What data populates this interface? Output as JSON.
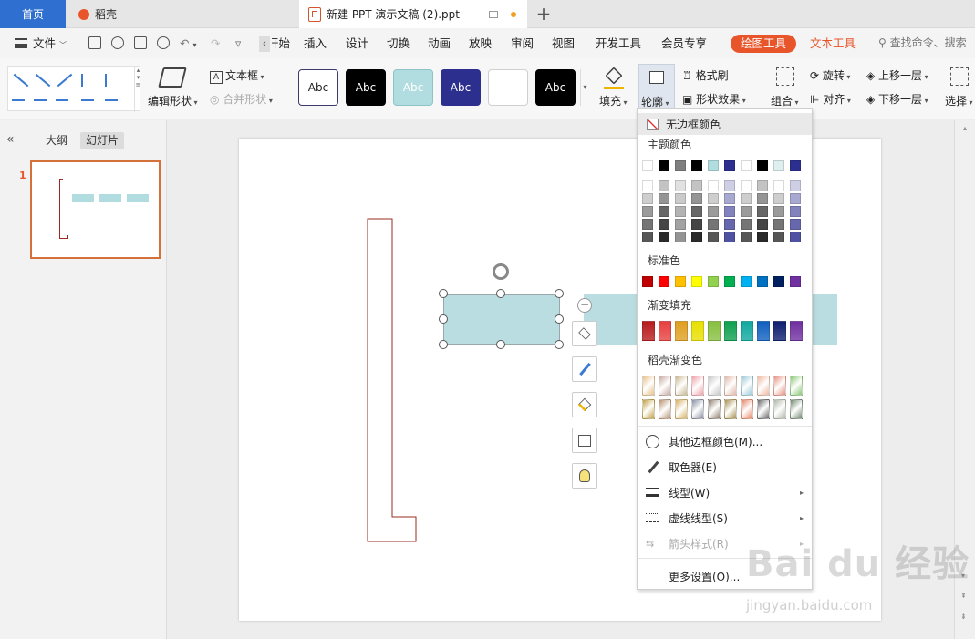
{
  "tabs": {
    "home": "首页",
    "daoke": "稻壳",
    "document": "新建 PPT 演示文稿 (2).ppt",
    "new_tab": "+"
  },
  "menubar": {
    "file": "文件",
    "items": [
      "开始",
      "插入",
      "设计",
      "切换",
      "动画",
      "放映",
      "审阅",
      "视图",
      "开发工具",
      "会员专享"
    ],
    "drawing_tools": "绘图工具",
    "text_tools": "文本工具",
    "search_placeholder": "查找命令、搜索模板"
  },
  "ribbon": {
    "edit_shape": "编辑形状",
    "text_box": "文本框",
    "merge_shape": "合并形状",
    "style_samples": [
      {
        "label": "Abc",
        "bg": "#ffffff",
        "fg": "#222222",
        "border": "#3b3b6b"
      },
      {
        "label": "Abc",
        "bg": "#000000",
        "fg": "#ffffff",
        "border": "#000000"
      },
      {
        "label": "Abc",
        "bg": "#b2dde0",
        "fg": "#ffffff",
        "border": "#8cc4c8"
      },
      {
        "label": "Abc",
        "bg": "#2d2f8f",
        "fg": "#ffffff",
        "border": "#2d2f8f"
      },
      {
        "label": "",
        "bg": "#ffffff",
        "fg": "#222222",
        "border": "#cfcfcf"
      },
      {
        "label": "Abc",
        "bg": "#000000",
        "fg": "#ffffff",
        "border": "#000000"
      }
    ],
    "fill": "填充",
    "outline": "轮廓",
    "format_painter": "格式刷",
    "shape_effects": "形状效果",
    "group": "组合",
    "rotate": "旋转",
    "align": "对齐",
    "bring_forward": "上移一层",
    "send_backward": "下移一层",
    "select": "选择"
  },
  "left_panel": {
    "outline_tab": "大纲",
    "slides_tab": "幻灯片",
    "slide_number": "1"
  },
  "dropdown": {
    "no_border": "无边框颜色",
    "theme_colors": "主题颜色",
    "theme_row": [
      "#ffffff",
      "#000000",
      "#7f7f7f",
      "#000000",
      "#b2dde0",
      "#2d2f8f",
      "#ffffff",
      "#000000",
      "#dfeff0",
      "#2d2f8f"
    ],
    "standard_colors": "标准色",
    "standard_row": [
      "#c00000",
      "#ff0000",
      "#ffc000",
      "#ffff00",
      "#92d050",
      "#00b050",
      "#00b0f0",
      "#0070c0",
      "#002060",
      "#7030a0"
    ],
    "gradient_fill": "渐变填充",
    "gradient_row": [
      "#b81c1c",
      "#e84040",
      "#e0a020",
      "#e8e000",
      "#88c040",
      "#10a050",
      "#10a8a0",
      "#1060c0",
      "#102070",
      "#7030a0"
    ],
    "daoke_gradients": "稻壳渐变色",
    "more_colors": "其他边框颜色(M)...",
    "eyedropper": "取色器(E)",
    "line_type": "线型(W)",
    "dash_type": "虚线线型(S)",
    "arrow_style": "箭头样式(R)",
    "more_settings": "更多设置(O)..."
  },
  "watermark": {
    "brand": "Bai du 经验",
    "url": "jingyan.baidu.com"
  }
}
